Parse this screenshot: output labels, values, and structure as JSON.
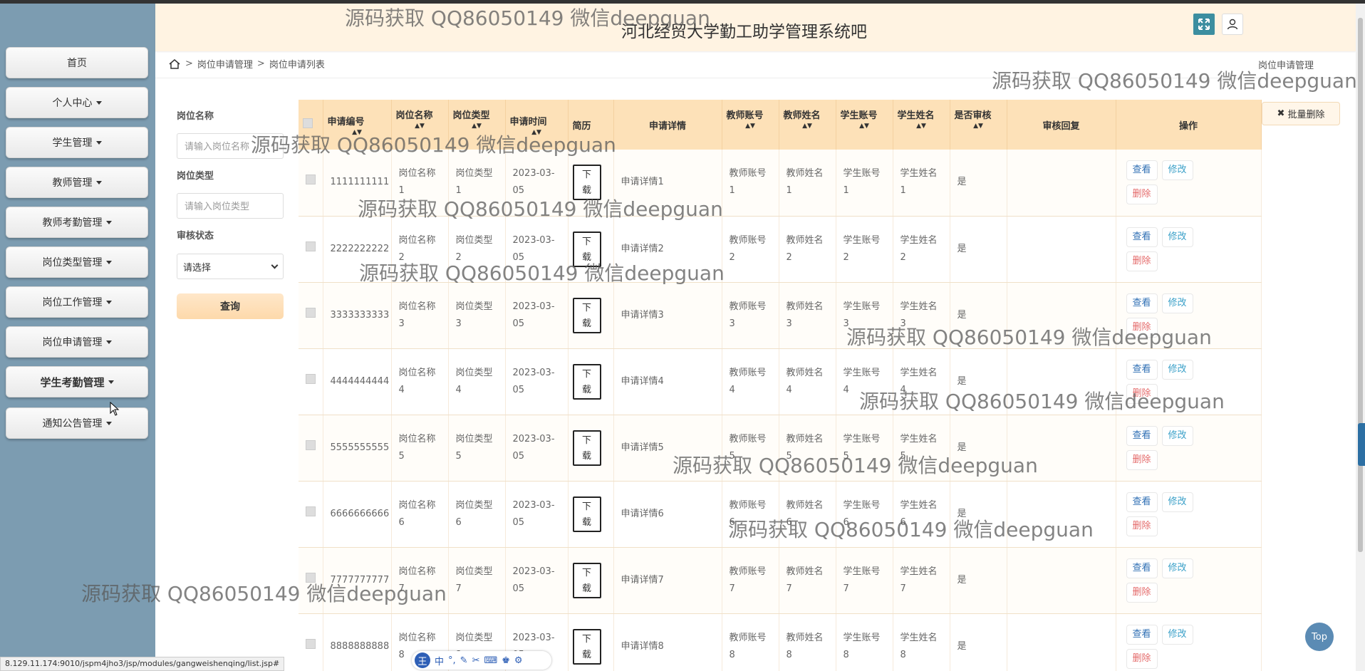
{
  "sidebar": {
    "items": [
      {
        "label": "首页",
        "caret": false
      },
      {
        "label": "个人中心",
        "caret": true
      },
      {
        "label": "学生管理",
        "caret": true
      },
      {
        "label": "教师管理",
        "caret": true
      },
      {
        "label": "教师考勤管理",
        "caret": true
      },
      {
        "label": "岗位类型管理",
        "caret": true
      },
      {
        "label": "岗位工作管理",
        "caret": true
      },
      {
        "label": "岗位申请管理",
        "caret": true
      },
      {
        "label": "学生考勤管理",
        "caret": true
      },
      {
        "label": "通知公告管理",
        "caret": true
      }
    ]
  },
  "header": {
    "title": "河北经贸大学勤工助学管理系统吧"
  },
  "breadcrumb": {
    "level1": "岗位申请管理",
    "level2": "岗位申请列表",
    "sep": ">",
    "right": "岗位申请管理"
  },
  "filter": {
    "name_label": "岗位名称",
    "name_placeholder": "请输入岗位名称",
    "type_label": "岗位类型",
    "type_placeholder": "请输入岗位类型",
    "status_label": "审核状态",
    "status_value": "请选择",
    "query_label": "查询"
  },
  "batch_delete_label": "批量删除",
  "table": {
    "headers": [
      "申请编号",
      "岗位名称",
      "岗位类型",
      "申请时间",
      "简历",
      "申请详情",
      "教师账号",
      "教师姓名",
      "学生账号",
      "学生姓名",
      "是否审核",
      "审核回复",
      "操作"
    ],
    "download_top": "下",
    "download_bottom": "载",
    "ops": {
      "view": "查看",
      "edit": "修改",
      "del": "删除"
    },
    "rows": [
      {
        "id": "1111111111",
        "name": [
          "岗位名称",
          "1"
        ],
        "type": [
          "岗位类型",
          "1"
        ],
        "time": [
          "2023-03-",
          "05"
        ],
        "detail": "申请详情1",
        "tacc": [
          "教师账号",
          "1"
        ],
        "tname": [
          "教师姓名",
          "1"
        ],
        "sacc": [
          "学生账号",
          "1"
        ],
        "sname": [
          "学生姓名",
          "1"
        ],
        "audit": "是"
      },
      {
        "id": "2222222222",
        "name": [
          "岗位名称",
          "2"
        ],
        "type": [
          "岗位类型",
          "2"
        ],
        "time": [
          "2023-03-",
          "05"
        ],
        "detail": "申请详情2",
        "tacc": [
          "教师账号",
          "2"
        ],
        "tname": [
          "教师姓名",
          "2"
        ],
        "sacc": [
          "学生账号",
          "2"
        ],
        "sname": [
          "学生姓名",
          "2"
        ],
        "audit": "是"
      },
      {
        "id": "3333333333",
        "name": [
          "岗位名称",
          "3"
        ],
        "type": [
          "岗位类型",
          "3"
        ],
        "time": [
          "2023-03-",
          "05"
        ],
        "detail": "申请详情3",
        "tacc": [
          "教师账号",
          "3"
        ],
        "tname": [
          "教师姓名",
          "3"
        ],
        "sacc": [
          "学生账号",
          "3"
        ],
        "sname": [
          "学生姓名",
          "3"
        ],
        "audit": "是"
      },
      {
        "id": "4444444444",
        "name": [
          "岗位名称",
          "4"
        ],
        "type": [
          "岗位类型",
          "4"
        ],
        "time": [
          "2023-03-",
          "05"
        ],
        "detail": "申请详情4",
        "tacc": [
          "教师账号",
          "4"
        ],
        "tname": [
          "教师姓名",
          "4"
        ],
        "sacc": [
          "学生账号",
          "4"
        ],
        "sname": [
          "学生姓名",
          "4"
        ],
        "audit": "是"
      },
      {
        "id": "5555555555",
        "name": [
          "岗位名称",
          "5"
        ],
        "type": [
          "岗位类型",
          "5"
        ],
        "time": [
          "2023-03-",
          "05"
        ],
        "detail": "申请详情5",
        "tacc": [
          "教师账号",
          "5"
        ],
        "tname": [
          "教师姓名",
          "5"
        ],
        "sacc": [
          "学生账号",
          "5"
        ],
        "sname": [
          "学生姓名",
          "5"
        ],
        "audit": "是"
      },
      {
        "id": "6666666666",
        "name": [
          "岗位名称",
          "6"
        ],
        "type": [
          "岗位类型",
          "6"
        ],
        "time": [
          "2023-03-",
          "05"
        ],
        "detail": "申请详情6",
        "tacc": [
          "教师账号",
          "6"
        ],
        "tname": [
          "教师姓名",
          "6"
        ],
        "sacc": [
          "学生账号",
          "6"
        ],
        "sname": [
          "学生姓名",
          "6"
        ],
        "audit": "是"
      },
      {
        "id": "7777777777",
        "name": [
          "岗位名称",
          "7"
        ],
        "type": [
          "岗位类型",
          "7"
        ],
        "time": [
          "2023-03-",
          "05"
        ],
        "detail": "申请详情7",
        "tacc": [
          "教师账号",
          "7"
        ],
        "tname": [
          "教师姓名",
          "7"
        ],
        "sacc": [
          "学生账号",
          "7"
        ],
        "sname": [
          "学生姓名",
          "7"
        ],
        "audit": "是"
      },
      {
        "id": "8888888888",
        "name": [
          "岗位名称",
          "8"
        ],
        "type": [
          "岗位类型",
          "8"
        ],
        "time": [
          "2023-03-",
          "05"
        ],
        "detail": "申请详情8",
        "tacc": [
          "教师账号",
          "8"
        ],
        "tname": [
          "教师姓名",
          "8"
        ],
        "sacc": [
          "学生账号",
          "8"
        ],
        "sname": [
          "学生姓名",
          "8"
        ],
        "audit": "是"
      }
    ]
  },
  "watermark_text": "源码获取 QQ86050149 微信deepguan",
  "status_url": "8.129.11.174:9010/jspm4jho3/jsp/modules/gangweishenqing/list.jsp#",
  "top_button_label": "Top",
  "ime": {
    "logo": "王",
    "mode": "中"
  },
  "colors": {
    "sidebar": "#7c9cb1",
    "header": "#fff3e2",
    "table_header": "#fde1b8",
    "query_button": "#fdd9ab",
    "expand_button": "#3c8ea0"
  }
}
